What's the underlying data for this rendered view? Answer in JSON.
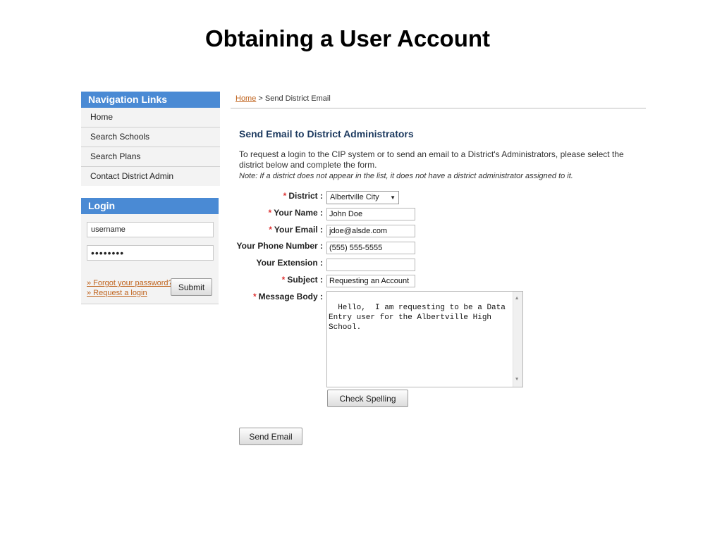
{
  "slide": {
    "title": "Obtaining a User Account"
  },
  "nav": {
    "header": "Navigation Links",
    "items": [
      {
        "label": "Home"
      },
      {
        "label": "Search Schools"
      },
      {
        "label": "Search Plans"
      },
      {
        "label": "Contact District Admin"
      }
    ]
  },
  "login": {
    "header": "Login",
    "username_value": "username",
    "password_value": "••••••••",
    "forgot_link": "» Forgot your password?",
    "request_link": "» Request a login",
    "submit_label": "Submit"
  },
  "breadcrumb": {
    "home": "Home",
    "separator": " > ",
    "current": "Send District Email"
  },
  "page": {
    "heading": "Send Email to District Administrators",
    "intro": "To request a login to the CIP system or to send an email to a District's Administrators, please select the district below and complete the form.",
    "note": "Note: If a district does not appear in the list, it does not have a district administrator assigned to it."
  },
  "form": {
    "required_marker": "*",
    "district_label": "District :",
    "district_value": "Albertville City",
    "name_label": "Your Name :",
    "name_value": "John Doe",
    "email_label": "Your Email :",
    "email_value": "jdoe@alsde.com",
    "phone_label": "Your Phone Number :",
    "phone_value": "(555) 555-5555",
    "extension_label": "Your Extension :",
    "extension_value": "",
    "subject_label": "Subject :",
    "subject_value": "Requesting an Account",
    "message_label": "Message Body :",
    "message_value": "Hello,  I am requesting to be a Data\nEntry user for the Albertville High\nSchool.",
    "spell_button": "Check Spelling",
    "send_button": "Send Email"
  },
  "colors": {
    "nav_header": "#4a8ad4",
    "link": "#c0641e",
    "heading": "#1d3a5f",
    "required": "#dd3333"
  },
  "icons": {
    "dropdown": "chevron-down-icon",
    "scroll_up": "scroll-up-icon",
    "scroll_down": "scroll-down-icon"
  }
}
